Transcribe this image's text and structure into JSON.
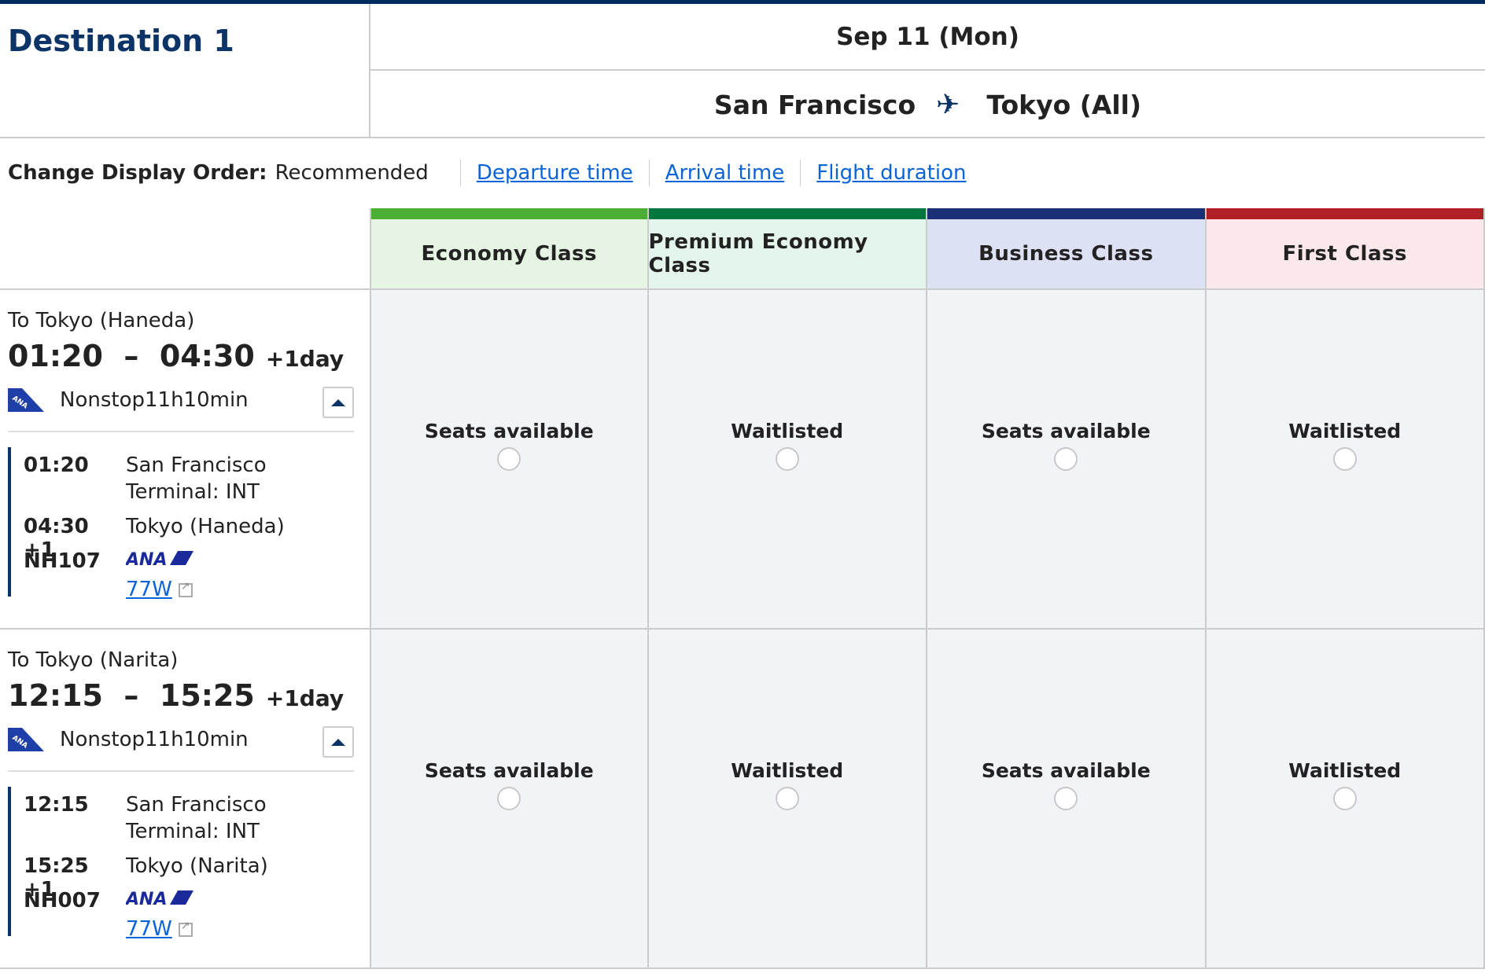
{
  "header": {
    "title": "Destination 1",
    "date": "Sep 11 (Mon)",
    "origin": "San Francisco",
    "destination": "Tokyo (All)",
    "route_icon": "airplane-icon"
  },
  "sort": {
    "label": "Change Display Order:",
    "current": "Recommended",
    "options": [
      "Departure time",
      "Arrival time",
      "Flight duration"
    ]
  },
  "classes": [
    {
      "label": "Economy Class",
      "bar_color": "#4caf35",
      "bg_color": "#e6f5e3"
    },
    {
      "label": "Premium Economy Class",
      "bar_color": "#00773f",
      "bg_color": "#e4f5ec"
    },
    {
      "label": "Business Class",
      "bar_color": "#1e2f7a",
      "bg_color": "#dde1f4"
    },
    {
      "label": "First Class",
      "bar_color": "#b01e26",
      "bg_color": "#fae8ea"
    }
  ],
  "flights": [
    {
      "to": "To Tokyo (Haneda)",
      "times": "01:20  –  04:30",
      "plus_day": "+1day",
      "nonstop": "Nonstop11h10min",
      "dep_time": "01:20",
      "dep_airport": "San Francisco",
      "terminal": "Terminal: INT",
      "arr_time": "04:30 +1",
      "arr_airport": "Tokyo (Haneda)",
      "flight_no": "NH107",
      "airline": "ANA",
      "equipment": "77W",
      "availability": [
        "Seats available",
        "Waitlisted",
        "Seats available",
        "Waitlisted"
      ]
    },
    {
      "to": "To Tokyo (Narita)",
      "times": "12:15  –  15:25",
      "plus_day": "+1day",
      "nonstop": "Nonstop11h10min",
      "dep_time": "12:15",
      "dep_airport": "San Francisco",
      "terminal": "Terminal: INT",
      "arr_time": "15:25 +1",
      "arr_airport": "Tokyo (Narita)",
      "flight_no": "NH007",
      "airline": "ANA",
      "equipment": "77W",
      "availability": [
        "Seats available",
        "Waitlisted",
        "Seats available",
        "Waitlisted"
      ]
    }
  ],
  "colors": {
    "brand_navy": "#0c3466",
    "link": "#0a64d8",
    "cell_bg": "#f2f3f7"
  }
}
